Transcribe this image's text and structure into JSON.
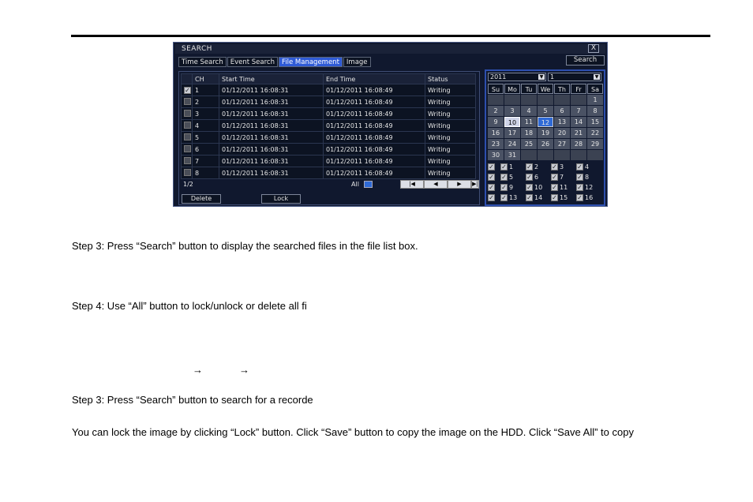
{
  "window": {
    "title": "SEARCH",
    "close_glyph": "X"
  },
  "tabs": [
    "Time Search",
    "Event Search",
    "File Management",
    "Image"
  ],
  "search_button": "Search",
  "file_table": {
    "headers": [
      "CH",
      "Start Time",
      "End Time",
      "Status"
    ],
    "rows": [
      {
        "ch": "1",
        "start": "01/12/2011 16:08:31",
        "end": "01/12/2011 16:08:49",
        "status": "Writing",
        "checked": true
      },
      {
        "ch": "2",
        "start": "01/12/2011 16:08:31",
        "end": "01/12/2011 16:08:49",
        "status": "Writing",
        "checked": false
      },
      {
        "ch": "3",
        "start": "01/12/2011 16:08:31",
        "end": "01/12/2011 16:08:49",
        "status": "Writing",
        "checked": false
      },
      {
        "ch": "4",
        "start": "01/12/2011 16:08:31",
        "end": "01/12/2011 16:08:49",
        "status": "Writing",
        "checked": false
      },
      {
        "ch": "5",
        "start": "01/12/2011 16:08:31",
        "end": "01/12/2011 16:08:49",
        "status": "Writing",
        "checked": false
      },
      {
        "ch": "6",
        "start": "01/12/2011 16:08:31",
        "end": "01/12/2011 16:08:49",
        "status": "Writing",
        "checked": false
      },
      {
        "ch": "7",
        "start": "01/12/2011 16:08:31",
        "end": "01/12/2011 16:08:49",
        "status": "Writing",
        "checked": false
      },
      {
        "ch": "8",
        "start": "01/12/2011 16:08:31",
        "end": "01/12/2011 16:08:49",
        "status": "Writing",
        "checked": false
      }
    ]
  },
  "pager": {
    "page": "1/2",
    "all_label": "All"
  },
  "actions": {
    "delete": "Delete",
    "lock": "Lock"
  },
  "calendar": {
    "year": "2011",
    "month": "1",
    "weekdays": [
      "Su",
      "Mo",
      "Tu",
      "We",
      "Th",
      "Fr",
      "Sa"
    ],
    "weeks": [
      [
        "",
        "",
        "",
        "",
        "",
        "",
        "1"
      ],
      [
        "2",
        "3",
        "4",
        "5",
        "6",
        "7",
        "8"
      ],
      [
        "9",
        "10",
        "11",
        "12",
        "13",
        "14",
        "15"
      ],
      [
        "16",
        "17",
        "18",
        "19",
        "20",
        "21",
        "22"
      ],
      [
        "23",
        "24",
        "25",
        "26",
        "27",
        "28",
        "29"
      ],
      [
        "30",
        "31",
        "",
        "",
        "",
        "",
        ""
      ]
    ],
    "channels": [
      [
        "1",
        "2",
        "3",
        "4"
      ],
      [
        "5",
        "6",
        "7",
        "8"
      ],
      [
        "9",
        "10",
        "11",
        "12"
      ],
      [
        "13",
        "14",
        "15",
        "16"
      ]
    ]
  },
  "paragraphs": {
    "p1": "Step 3: Press “Search” button to display the searched files in the file list box.",
    "p2": "Step 4: Use “All” button to lock/unlock or delete all fi",
    "arrow": "→",
    "p3": "Step 3: Press “Search” button to search for a recorde",
    "p4": "You can lock the image by clicking “Lock” button. Click “Save” button to copy the image on the HDD. Click “Save All” to copy"
  },
  "colors": {
    "accent": "#2f5bd6",
    "panel_bg": "#10182e"
  }
}
